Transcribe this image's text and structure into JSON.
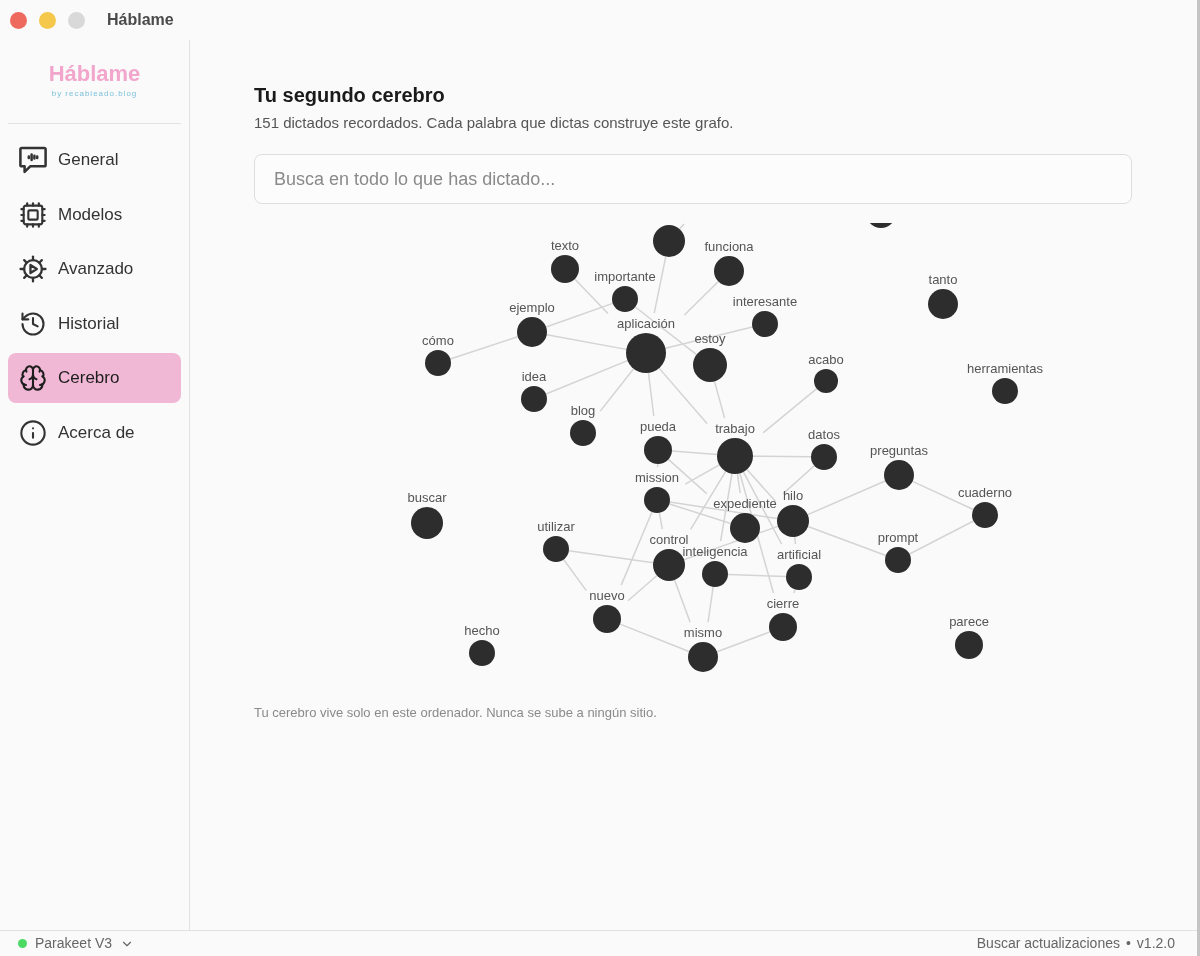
{
  "window": {
    "title": "Háblame",
    "buttons": [
      {
        "kind": "close",
        "disabled": false
      },
      {
        "kind": "minimize",
        "disabled": false
      },
      {
        "kind": "zoom",
        "disabled": true
      }
    ]
  },
  "sidebar": {
    "logo": {
      "title": "Háblame",
      "subtitle": "by recableado.blog"
    },
    "items": [
      {
        "label": "General",
        "selected": false
      },
      {
        "label": "Modelos",
        "selected": false
      },
      {
        "label": "Avanzado",
        "selected": false
      },
      {
        "label": "Historial",
        "selected": false
      },
      {
        "label": "Cerebro",
        "selected": true
      },
      {
        "label": "Acerca de",
        "selected": false
      }
    ]
  },
  "page": {
    "title": "Tu segundo cerebro",
    "subtitle": "151 dictados recordados. Cada palabra que dictas construye este grafo.",
    "search": {
      "placeholder": "Busca en todo lo que has dictado..."
    }
  },
  "graph": {
    "nodes": [
      {
        "label": "texto"
      },
      {
        "label": "funciona"
      },
      {
        "label": "importante"
      },
      {
        "label": "tanto"
      },
      {
        "label": "interesante"
      },
      {
        "label": "ejemplo"
      },
      {
        "label": "aplicación"
      },
      {
        "label": "estoy"
      },
      {
        "label": "cómo"
      },
      {
        "label": "acabo"
      },
      {
        "label": "herramientas"
      },
      {
        "label": "idea"
      },
      {
        "label": "blog"
      },
      {
        "label": "pueda"
      },
      {
        "label": "trabajo"
      },
      {
        "label": "datos"
      },
      {
        "label": "preguntas"
      },
      {
        "label": "mission"
      },
      {
        "label": "hilo"
      },
      {
        "label": "expediente"
      },
      {
        "label": "cuaderno"
      },
      {
        "label": "buscar"
      },
      {
        "label": "utilizar"
      },
      {
        "label": "control"
      },
      {
        "label": "inteligencia"
      },
      {
        "label": "artificial"
      },
      {
        "label": "prompt"
      },
      {
        "label": "nuevo"
      },
      {
        "label": "cierre"
      },
      {
        "label": "parece"
      },
      {
        "label": "hecho"
      },
      {
        "label": "mismo"
      }
    ]
  },
  "note": "Tu cerebro vive solo en este ordenador. Nunca se sube a ningún sitio.",
  "status_bar": {
    "model": {
      "label": "Parakeet V3",
      "ready": true
    },
    "update_link": "Buscar actualizaciones",
    "separator": "•",
    "version": "v1.2.0"
  }
}
